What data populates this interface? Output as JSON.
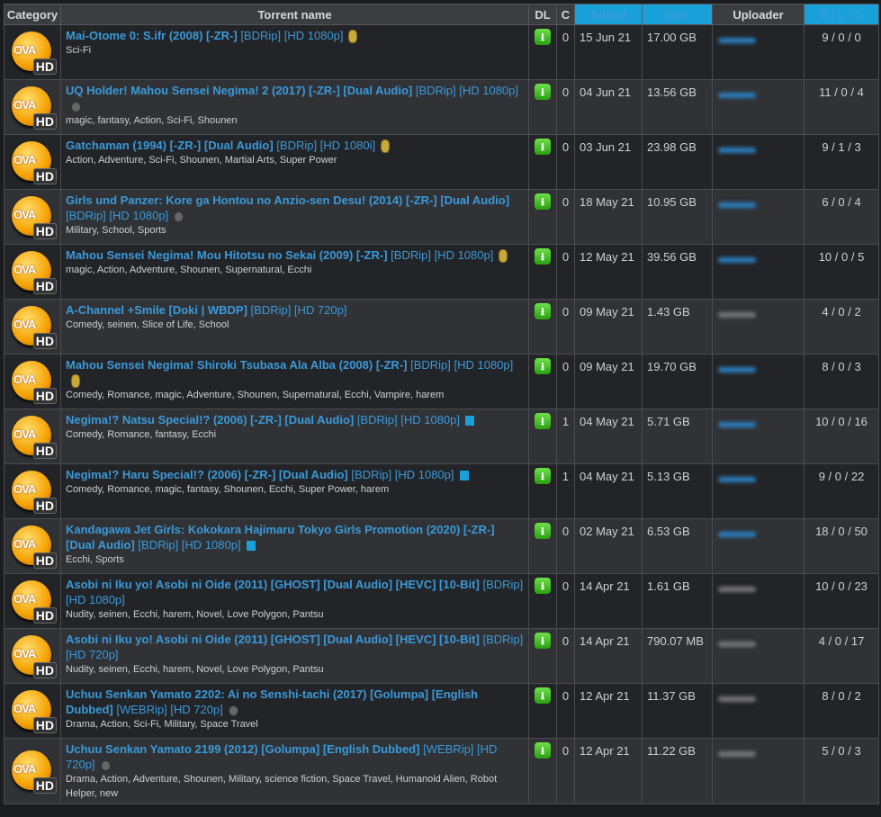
{
  "headers": {
    "category": "Category",
    "name": "Torrent name",
    "dl": "DL",
    "c": "C",
    "added": "Added",
    "size": "Size",
    "uploader": "Uploader",
    "slc": "S / L / C"
  },
  "category_icon": {
    "top": "OVA",
    "bottom": "HD"
  },
  "colors": {
    "link": "#3a9ad9",
    "row_odd": "#232427",
    "row_even": "#303236"
  },
  "rows": [
    {
      "bold": "Mai-Otome 0: S.ifr (2008) [-ZR-]",
      "normal": "[BDRip] [HD 1080p]",
      "badge": "coin",
      "tags": "Sci-Fi",
      "c": "0",
      "added": "15 Jun 21",
      "size": "17.00 GB",
      "uploader_color": "blue",
      "slc": "9 / 0 / 0"
    },
    {
      "bold": "UQ Holder! Mahou Sensei Negima! 2 (2017) [-ZR-] [Dual Audio]",
      "normal": "[BDRip] [HD 1080p]",
      "badge": "gray",
      "tags": "magic, fantasy, Action, Sci-Fi, Shounen",
      "c": "0",
      "added": "04 Jun 21",
      "size": "13.56 GB",
      "uploader_color": "blue",
      "slc": "11 / 0 / 4"
    },
    {
      "bold": "Gatchaman (1994) [-ZR-] [Dual Audio]",
      "normal": "[BDRip] [HD 1080i]",
      "badge": "coin",
      "tags": "Action, Adventure, Sci-Fi, Shounen, Martial Arts, Super Power",
      "c": "0",
      "added": "03 Jun 21",
      "size": "23.98 GB",
      "uploader_color": "blue",
      "slc": "9 / 1 / 3"
    },
    {
      "bold": "Girls und Panzer: Kore ga Hontou no Anzio-sen Desu! (2014) [-ZR-] [Dual Audio]",
      "normal": "[BDRip] [HD 1080p]",
      "badge": "gray",
      "tags": "Military, School, Sports",
      "c": "0",
      "added": "18 May 21",
      "size": "10.95 GB",
      "uploader_color": "blue",
      "slc": "6 / 0 / 4"
    },
    {
      "bold": "Mahou Sensei Negima! Mou Hitotsu no Sekai (2009) [-ZR-]",
      "normal": "[BDRip] [HD 1080p]",
      "badge": "coin",
      "tags": "magic, Action, Adventure, Shounen, Supernatural, Ecchi",
      "c": "0",
      "added": "12 May 21",
      "size": "39.56 GB",
      "uploader_color": "blue",
      "slc": "10 / 0 / 5"
    },
    {
      "bold": "A-Channel +Smile [Doki | WBDP]",
      "normal": "[BDRip] [HD 720p]",
      "badge": "",
      "tags": "Comedy, seinen, Slice of Life, School",
      "c": "0",
      "added": "09 May 21",
      "size": "1.43 GB",
      "uploader_color": "gray",
      "slc": "4 / 0 / 2"
    },
    {
      "bold": "Mahou Sensei Negima! Shiroki Tsubasa Ala Alba (2008) [-ZR-]",
      "normal": "[BDRip] [HD 1080p]",
      "badge": "coin",
      "tags": "Comedy, Romance, magic, Adventure, Shounen, Supernatural, Ecchi, Vampire, harem",
      "c": "0",
      "added": "09 May 21",
      "size": "19.70 GB",
      "uploader_color": "blue",
      "slc": "8 / 0 / 3"
    },
    {
      "bold": "Negima!? Natsu Special!? (2006) [-ZR-] [Dual Audio]",
      "normal": "[BDRip] [HD 1080p]",
      "badge": "blue",
      "tags": "Comedy, Romance, fantasy, Ecchi",
      "c": "1",
      "added": "04 May 21",
      "size": "5.71 GB",
      "uploader_color": "blue",
      "slc": "10 / 0 / 16"
    },
    {
      "bold": "Negima!? Haru Special!? (2006) [-ZR-] [Dual Audio]",
      "normal": "[BDRip] [HD 1080p]",
      "badge": "blue",
      "tags": "Comedy, Romance, magic, fantasy, Shounen, Ecchi, Super Power, harem",
      "c": "1",
      "added": "04 May 21",
      "size": "5.13 GB",
      "uploader_color": "blue",
      "slc": "9 / 0 / 22"
    },
    {
      "bold": "Kandagawa Jet Girls: Kokokara Hajimaru Tokyo Girls Promotion (2020) [-ZR-] [Dual Audio]",
      "normal": "[BDRip] [HD 1080p]",
      "badge": "blue",
      "tags": "Ecchi, Sports",
      "c": "0",
      "added": "02 May 21",
      "size": "6.53 GB",
      "uploader_color": "blue",
      "slc": "18 / 0 / 50"
    },
    {
      "bold": "Asobi ni Iku yo! Asobi ni Oide (2011) [GHOST] [Dual Audio] [HEVC] [10-Bit]",
      "normal": "[BDRip] [HD 1080p]",
      "badge": "",
      "tags": "Nudity, seinen, Ecchi, harem, Novel, Love Polygon, Pantsu",
      "c": "0",
      "added": "14 Apr 21",
      "size": "1.61 GB",
      "uploader_color": "gray",
      "slc": "10 / 0 / 23"
    },
    {
      "bold": "Asobi ni Iku yo! Asobi ni Oide (2011) [GHOST] [Dual Audio] [HEVC] [10-Bit]",
      "normal": "[BDRip] [HD 720p]",
      "badge": "",
      "tags": "Nudity, seinen, Ecchi, harem, Novel, Love Polygon, Pantsu",
      "c": "0",
      "added": "14 Apr 21",
      "size": "790.07 MB",
      "uploader_color": "gray",
      "slc": "4 / 0 / 17"
    },
    {
      "bold": "Uchuu Senkan Yamato 2202: Ai no Senshi-tachi (2017) [Golumpa] [English Dubbed]",
      "normal": "[WEBRip] [HD 720p]",
      "badge": "gray",
      "tags": "Drama, Action, Sci-Fi, Military, Space Travel",
      "c": "0",
      "added": "12 Apr 21",
      "size": "11.37 GB",
      "uploader_color": "gray",
      "slc": "8 / 0 / 2"
    },
    {
      "bold": "Uchuu Senkan Yamato 2199 (2012) [Golumpa] [English Dubbed]",
      "normal": "[WEBRip] [HD 720p]",
      "badge": "gray",
      "tags": "Drama, Action, Adventure, Shounen, Military, science fiction, Space Travel, Humanoid Alien, Robot Helper, new",
      "c": "0",
      "added": "12 Apr 21",
      "size": "11.22 GB",
      "uploader_color": "gray",
      "slc": "5 / 0 / 3"
    }
  ]
}
